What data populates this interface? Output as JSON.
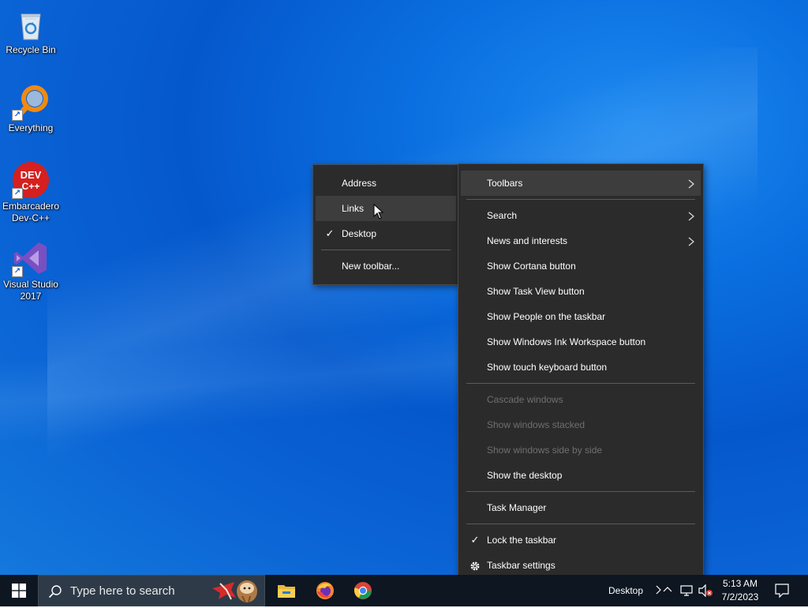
{
  "desktop": {
    "icons": [
      {
        "label": "Recycle Bin",
        "icon": "recycle-bin-icon"
      },
      {
        "label": "Everything",
        "icon": "magnifier-icon"
      },
      {
        "label": "Embarcadero Dev-C++",
        "icon": "devcpp-icon",
        "badge": "DEV C++"
      },
      {
        "label": "Visual Studio 2017",
        "icon": "visual-studio-icon"
      }
    ]
  },
  "context_menu": {
    "items": [
      {
        "label": "Toolbars",
        "submenu": true,
        "highlighted": true
      },
      {
        "label": "Search",
        "submenu": true
      },
      {
        "label": "News and interests",
        "submenu": true
      },
      {
        "label": "Show Cortana button"
      },
      {
        "label": "Show Task View button"
      },
      {
        "label": "Show People on the taskbar"
      },
      {
        "label": "Show Windows Ink Workspace button"
      },
      {
        "label": "Show touch keyboard button"
      },
      {
        "label": "Cascade windows",
        "disabled": true
      },
      {
        "label": "Show windows stacked",
        "disabled": true
      },
      {
        "label": "Show windows side by side",
        "disabled": true
      },
      {
        "label": "Show the desktop"
      },
      {
        "label": "Task Manager"
      },
      {
        "label": "Lock the taskbar",
        "checked": true
      },
      {
        "label": "Taskbar settings",
        "icon": "gear-icon"
      }
    ]
  },
  "toolbars_submenu": {
    "items": [
      {
        "label": "Address"
      },
      {
        "label": "Links",
        "highlighted": true
      },
      {
        "label": "Desktop",
        "checked": true
      },
      {
        "label": "New toolbar..."
      }
    ]
  },
  "taskbar": {
    "search_placeholder": "Type here to search",
    "pinned": [
      "file-explorer-icon",
      "firefox-icon",
      "chrome-icon"
    ],
    "desktop_toolbar_label": "Desktop",
    "clock": {
      "time": "5:13 AM",
      "date": "7/2/2023"
    }
  },
  "colors": {
    "menu_bg": "#2b2b2b",
    "menu_highlight": "#3d3d3d",
    "disabled_text": "#6f6f6f",
    "taskbar_bg": "#0d1621"
  }
}
